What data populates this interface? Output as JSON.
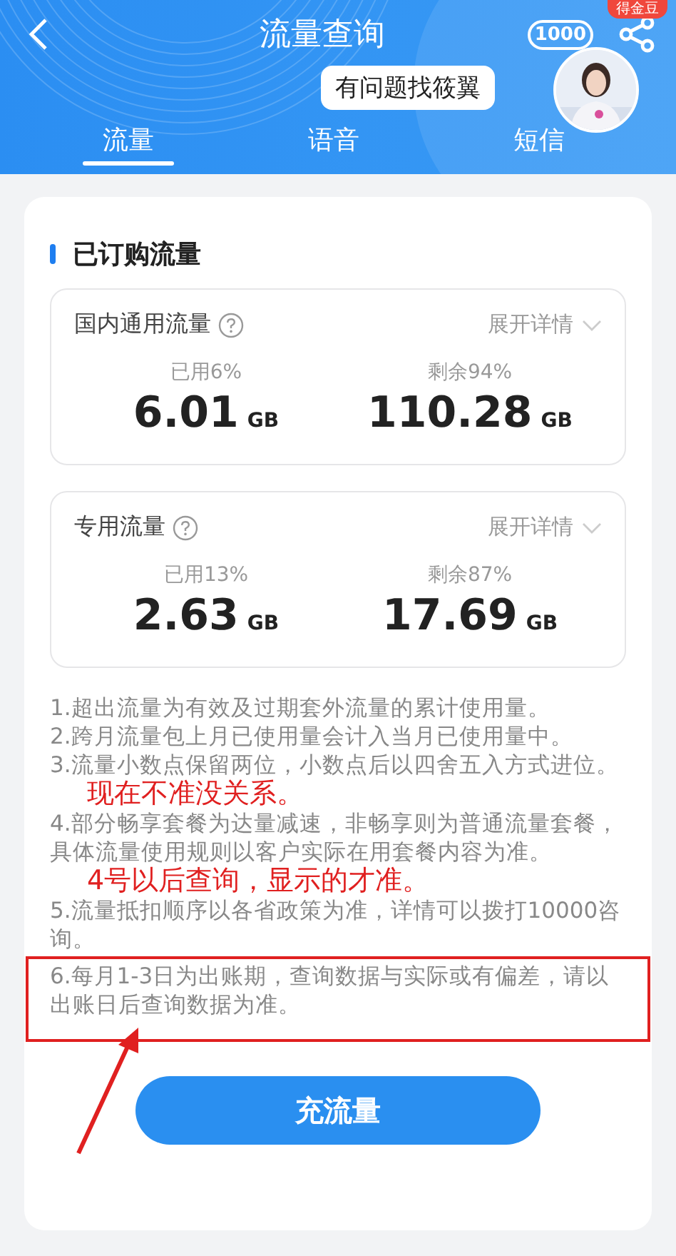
{
  "header": {
    "title": "流量查询",
    "hotline": "1000",
    "badge": "得金豆",
    "help_bubble": "有问题找筱翼"
  },
  "tabs": [
    {
      "label": "流量",
      "selected": true
    },
    {
      "label": "语音",
      "selected": false
    },
    {
      "label": "短信",
      "selected": false
    }
  ],
  "section": {
    "title": "已订购流量",
    "plans": [
      {
        "name": "国内通用流量",
        "expand": "展开详情",
        "used_label": "已用6%",
        "used": "6.01",
        "used_unit": "GB",
        "remaining_label": "剩余94%",
        "remaining": "110.28",
        "remaining_unit": "GB"
      },
      {
        "name": "专用流量",
        "expand": "展开详情",
        "used_label": "已用13%",
        "used": "2.63",
        "used_unit": "GB",
        "remaining_label": "剩余87%",
        "remaining": "17.69",
        "remaining_unit": "GB"
      }
    ]
  },
  "notes": [
    {
      "text": "1.超出流量为有效及过期套外流量的累计使用量。",
      "highlighted": false
    },
    {
      "text": "2.跨月流量包上月已使用量会计入当月已使用量中。",
      "highlighted": false
    },
    {
      "text": "3.流量小数点保留两位，小数点后以四舍五入方式进位。",
      "annotation": "现在不准没关系。",
      "highlighted": false
    },
    {
      "text": "4.部分畅享套餐为达量减速，非畅享则为普通流量套餐，具体流量使用规则以客户实际在用套餐内容为准。",
      "annotation": "4号以后查询，显示的才准。",
      "highlighted": false
    },
    {
      "text": "5.流量抵扣顺序以各省政策为准，详情可以拨打10000咨询。",
      "highlighted": false
    },
    {
      "text": "6.每月1-3日为出账期，查询数据与实际或有偏差，请以出账日后查询数据为准。",
      "highlighted": true
    }
  ],
  "button": "充流量"
}
